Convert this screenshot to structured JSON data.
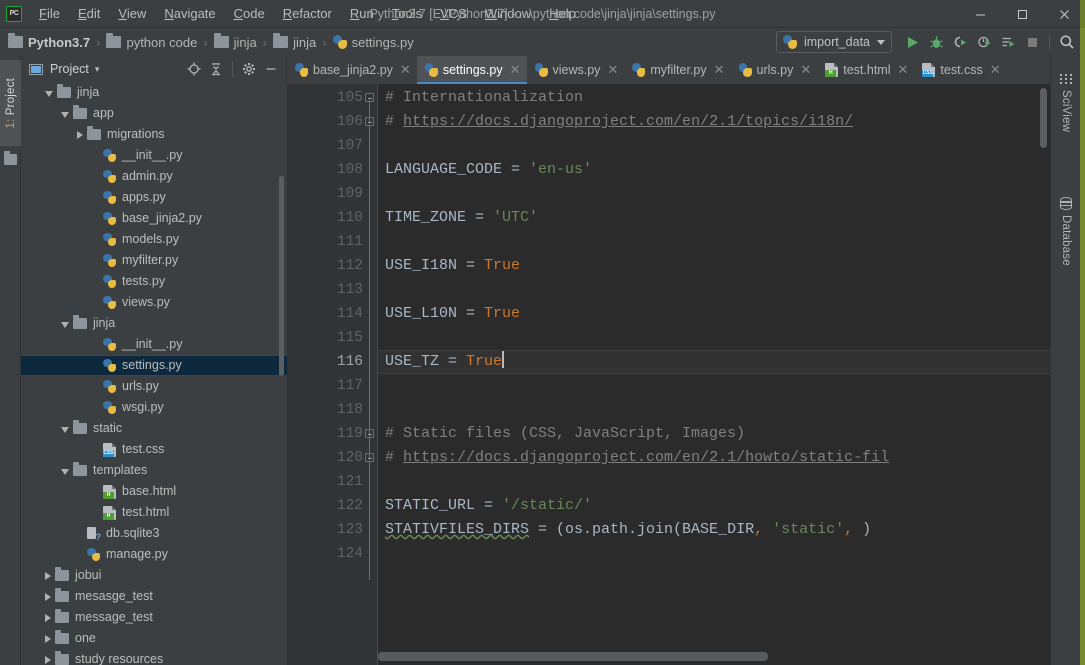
{
  "window": {
    "title": "Python3.7 [E:\\Python3.7] - ...\\python code\\jinja\\jinja\\settings.py",
    "logo": "pycharm-logo",
    "minimize": "—",
    "maximize": "□",
    "close": "✕"
  },
  "menu": {
    "items": [
      {
        "label": "File"
      },
      {
        "label": "Edit"
      },
      {
        "label": "View"
      },
      {
        "label": "Navigate"
      },
      {
        "label": "Code"
      },
      {
        "label": "Refactor"
      },
      {
        "label": "Run"
      },
      {
        "label": "Tools"
      },
      {
        "label": "VCS"
      },
      {
        "label": "Window"
      },
      {
        "label": "Help"
      }
    ]
  },
  "breadcrumb": {
    "separator": "›",
    "items": [
      {
        "label": "Python3.7",
        "icon": "folder-icon",
        "bold": true
      },
      {
        "label": "python code",
        "icon": "folder-icon",
        "bold": false
      },
      {
        "label": "jinja",
        "icon": "folder-icon",
        "bold": false
      },
      {
        "label": "jinja",
        "icon": "folder-icon",
        "bold": false
      },
      {
        "label": "settings.py",
        "icon": "python-file-icon",
        "bold": false
      }
    ]
  },
  "toolbar": {
    "run_config": "import_data",
    "run_config_icon": "python-file-icon",
    "buttons": [
      {
        "name": "run-button",
        "icon": "play-icon"
      },
      {
        "name": "debug-button",
        "icon": "bug-icon"
      },
      {
        "name": "run-with-coverage-button",
        "icon": "coverage-icon"
      },
      {
        "name": "profile-button",
        "icon": "profile-icon"
      },
      {
        "name": "run-tests-button",
        "icon": "run-list-icon"
      },
      {
        "name": "stop-button",
        "icon": "stop-icon"
      },
      {
        "name": "search-everywhere-button",
        "icon": "search-icon"
      }
    ]
  },
  "left_stripe": {
    "tool_window": "1: Project",
    "number": "1:",
    "name": " Project"
  },
  "right_stripe": {
    "tabs": [
      {
        "label": "SciView",
        "icon": "grid-icon"
      },
      {
        "label": "Database",
        "icon": "database-icon"
      }
    ]
  },
  "project_panel": {
    "title": "Project",
    "title_caret": "▾",
    "actions": [
      {
        "name": "select-opened-file-button",
        "icon": "target-icon"
      },
      {
        "name": "collapse-all-button",
        "icon": "collapse-all-icon"
      },
      {
        "name": "settings-button",
        "icon": "gear-icon"
      },
      {
        "name": "hide-button",
        "icon": "minimize-icon"
      }
    ],
    "tree": [
      {
        "label": "jinja",
        "icon": "folder-icon",
        "indent": 2,
        "arrow": "open",
        "selected": false
      },
      {
        "label": "app",
        "icon": "folder-icon",
        "indent": 3,
        "arrow": "open",
        "selected": false
      },
      {
        "label": "migrations",
        "icon": "folder-icon",
        "indent": 4,
        "arrow": "closed",
        "selected": false
      },
      {
        "label": "__init__.py",
        "icon": "python-file-icon",
        "indent": 5,
        "arrow": "none",
        "selected": false
      },
      {
        "label": "admin.py",
        "icon": "python-file-icon",
        "indent": 5,
        "arrow": "none",
        "selected": false
      },
      {
        "label": "apps.py",
        "icon": "python-file-icon",
        "indent": 5,
        "arrow": "none",
        "selected": false
      },
      {
        "label": "base_jinja2.py",
        "icon": "python-file-icon",
        "indent": 5,
        "arrow": "none",
        "selected": false
      },
      {
        "label": "models.py",
        "icon": "python-file-icon",
        "indent": 5,
        "arrow": "none",
        "selected": false
      },
      {
        "label": "myfilter.py",
        "icon": "python-file-icon",
        "indent": 5,
        "arrow": "none",
        "selected": false
      },
      {
        "label": "tests.py",
        "icon": "python-file-icon",
        "indent": 5,
        "arrow": "none",
        "selected": false
      },
      {
        "label": "views.py",
        "icon": "python-file-icon",
        "indent": 5,
        "arrow": "none",
        "selected": false
      },
      {
        "label": "jinja",
        "icon": "folder-icon",
        "indent": 3,
        "arrow": "open",
        "selected": false
      },
      {
        "label": "__init__.py",
        "icon": "python-file-icon",
        "indent": 5,
        "arrow": "none",
        "selected": false
      },
      {
        "label": "settings.py",
        "icon": "python-file-icon",
        "indent": 5,
        "arrow": "none",
        "selected": true
      },
      {
        "label": "urls.py",
        "icon": "python-file-icon",
        "indent": 5,
        "arrow": "none",
        "selected": false
      },
      {
        "label": "wsgi.py",
        "icon": "python-file-icon",
        "indent": 5,
        "arrow": "none",
        "selected": false
      },
      {
        "label": "static",
        "icon": "folder-icon",
        "indent": 3,
        "arrow": "open",
        "selected": false
      },
      {
        "label": "test.css",
        "icon": "css-file-icon",
        "indent": 5,
        "arrow": "none",
        "selected": false
      },
      {
        "label": "templates",
        "icon": "folder-icon",
        "indent": 3,
        "arrow": "open",
        "selected": false
      },
      {
        "label": "base.html",
        "icon": "html-file-icon",
        "indent": 5,
        "arrow": "none",
        "selected": false
      },
      {
        "label": "test.html",
        "icon": "html-file-icon",
        "indent": 5,
        "arrow": "none",
        "selected": false
      },
      {
        "label": "db.sqlite3",
        "icon": "sqlite-file-icon",
        "indent": 4,
        "arrow": "none",
        "selected": false
      },
      {
        "label": "manage.py",
        "icon": "python-file-icon",
        "indent": 4,
        "arrow": "none",
        "selected": false
      },
      {
        "label": "jobui",
        "icon": "folder-icon",
        "indent": 2,
        "arrow": "closed",
        "selected": false
      },
      {
        "label": "mesasge_test",
        "icon": "folder-icon",
        "indent": 2,
        "arrow": "closed",
        "selected": false
      },
      {
        "label": "message_test",
        "icon": "folder-icon",
        "indent": 2,
        "arrow": "closed",
        "selected": false
      },
      {
        "label": "one",
        "icon": "folder-icon",
        "indent": 2,
        "arrow": "closed",
        "selected": false
      },
      {
        "label": "study resources",
        "icon": "folder-icon",
        "indent": 2,
        "arrow": "closed",
        "selected": false
      }
    ]
  },
  "editor_tabs": {
    "close_glyph": "✕",
    "items": [
      {
        "label": "base_jinja2.py",
        "icon": "python-file-icon",
        "active": false
      },
      {
        "label": "settings.py",
        "icon": "python-file-icon",
        "active": true
      },
      {
        "label": "views.py",
        "icon": "python-file-icon",
        "active": false
      },
      {
        "label": "myfilter.py",
        "icon": "python-file-icon",
        "active": false
      },
      {
        "label": "urls.py",
        "icon": "python-file-icon",
        "active": false
      },
      {
        "label": "test.html",
        "icon": "html-file-icon",
        "active": false
      },
      {
        "label": "test.css",
        "icon": "css-file-icon",
        "active": false
      }
    ]
  },
  "editor": {
    "file": "settings.py",
    "caret_line": 116,
    "first_line": 105,
    "last_line": 124,
    "colors": {
      "background": "#2b2b2b",
      "gutter": "#313335",
      "text": "#a9b7c6",
      "comment": "#808080",
      "string": "#6a8759",
      "keyword": "#cc7832",
      "caret_row": "#323232"
    },
    "lines": [
      {
        "n": 105,
        "fold": true,
        "tokens": [
          {
            "t": "# Internationalization",
            "c": "cm"
          }
        ]
      },
      {
        "n": 106,
        "fold": true,
        "tokens": [
          {
            "t": "# ",
            "c": "cm"
          },
          {
            "t": "https://docs.djangoproject.com/en/2.1/topics/i18n/",
            "c": "cmu"
          }
        ]
      },
      {
        "n": 107,
        "fold": false,
        "tokens": []
      },
      {
        "n": 108,
        "fold": false,
        "tokens": [
          {
            "t": "LANGUAGE_CODE = ",
            "c": "id"
          },
          {
            "t": "'en-us'",
            "c": "st"
          }
        ]
      },
      {
        "n": 109,
        "fold": false,
        "tokens": []
      },
      {
        "n": 110,
        "fold": false,
        "tokens": [
          {
            "t": "TIME_ZONE = ",
            "c": "id"
          },
          {
            "t": "'UTC'",
            "c": "st"
          }
        ]
      },
      {
        "n": 111,
        "fold": false,
        "tokens": []
      },
      {
        "n": 112,
        "fold": false,
        "tokens": [
          {
            "t": "USE_I18N = ",
            "c": "id"
          },
          {
            "t": "True",
            "c": "kw"
          }
        ]
      },
      {
        "n": 113,
        "fold": false,
        "tokens": []
      },
      {
        "n": 114,
        "fold": false,
        "tokens": [
          {
            "t": "USE_L10N = ",
            "c": "id"
          },
          {
            "t": "True",
            "c": "kw"
          }
        ]
      },
      {
        "n": 115,
        "fold": false,
        "tokens": []
      },
      {
        "n": 116,
        "fold": false,
        "tokens": [
          {
            "t": "USE_TZ = ",
            "c": "id"
          },
          {
            "t": "True",
            "c": "kw"
          },
          {
            "t": "",
            "c": "caret"
          }
        ]
      },
      {
        "n": 117,
        "fold": false,
        "tokens": []
      },
      {
        "n": 118,
        "fold": false,
        "tokens": []
      },
      {
        "n": 119,
        "fold": true,
        "tokens": [
          {
            "t": "# Static files (CSS, JavaScript, Images)",
            "c": "cm"
          }
        ]
      },
      {
        "n": 120,
        "fold": true,
        "tokens": [
          {
            "t": "# ",
            "c": "cm"
          },
          {
            "t": "https://docs.djangoproject.com/en/2.1/howto/static-fil",
            "c": "cmu"
          }
        ]
      },
      {
        "n": 121,
        "fold": false,
        "tokens": []
      },
      {
        "n": 122,
        "fold": false,
        "tokens": [
          {
            "t": "STATIC_URL = ",
            "c": "id"
          },
          {
            "t": "'/static/'",
            "c": "st"
          }
        ]
      },
      {
        "n": 123,
        "fold": false,
        "tokens": [
          {
            "t": "STATIVFILES_DIRS",
            "c": "err"
          },
          {
            "t": " = (os.path.join(BASE_DIR",
            "c": "id"
          },
          {
            "t": ", ",
            "c": "kw"
          },
          {
            "t": "'static'",
            "c": "st"
          },
          {
            "t": ", ",
            "c": "kw"
          },
          {
            "t": ")",
            "c": "id"
          }
        ]
      },
      {
        "n": 124,
        "fold": false,
        "tokens": []
      }
    ]
  }
}
